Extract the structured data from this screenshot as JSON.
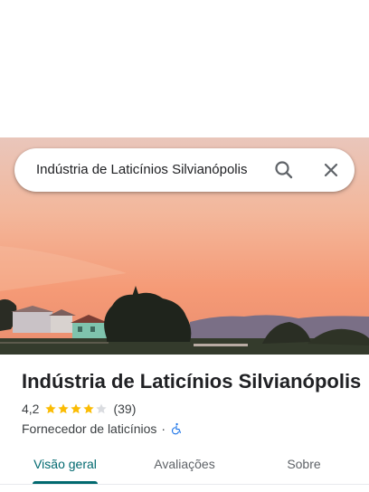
{
  "search": {
    "query": "Indústria de Laticínios Silvianópolis",
    "search_icon": "search-icon",
    "close_icon": "close-icon"
  },
  "place": {
    "name": "Indústria de Laticínios Silvianópolis",
    "rating": "4,2",
    "rating_stars": 4.2,
    "star_color": "#fbbc04",
    "review_count": "(39)",
    "category": "Fornecedor de laticínios",
    "separator": "·",
    "accessibility_icon": "wheelchair-icon",
    "accessibility_color": "#1a73e8"
  },
  "tabs": [
    {
      "label": "Visão geral",
      "active": true
    },
    {
      "label": "Avaliações",
      "active": false
    },
    {
      "label": "Sobre",
      "active": false
    }
  ],
  "colors": {
    "accent": "#01696f"
  }
}
